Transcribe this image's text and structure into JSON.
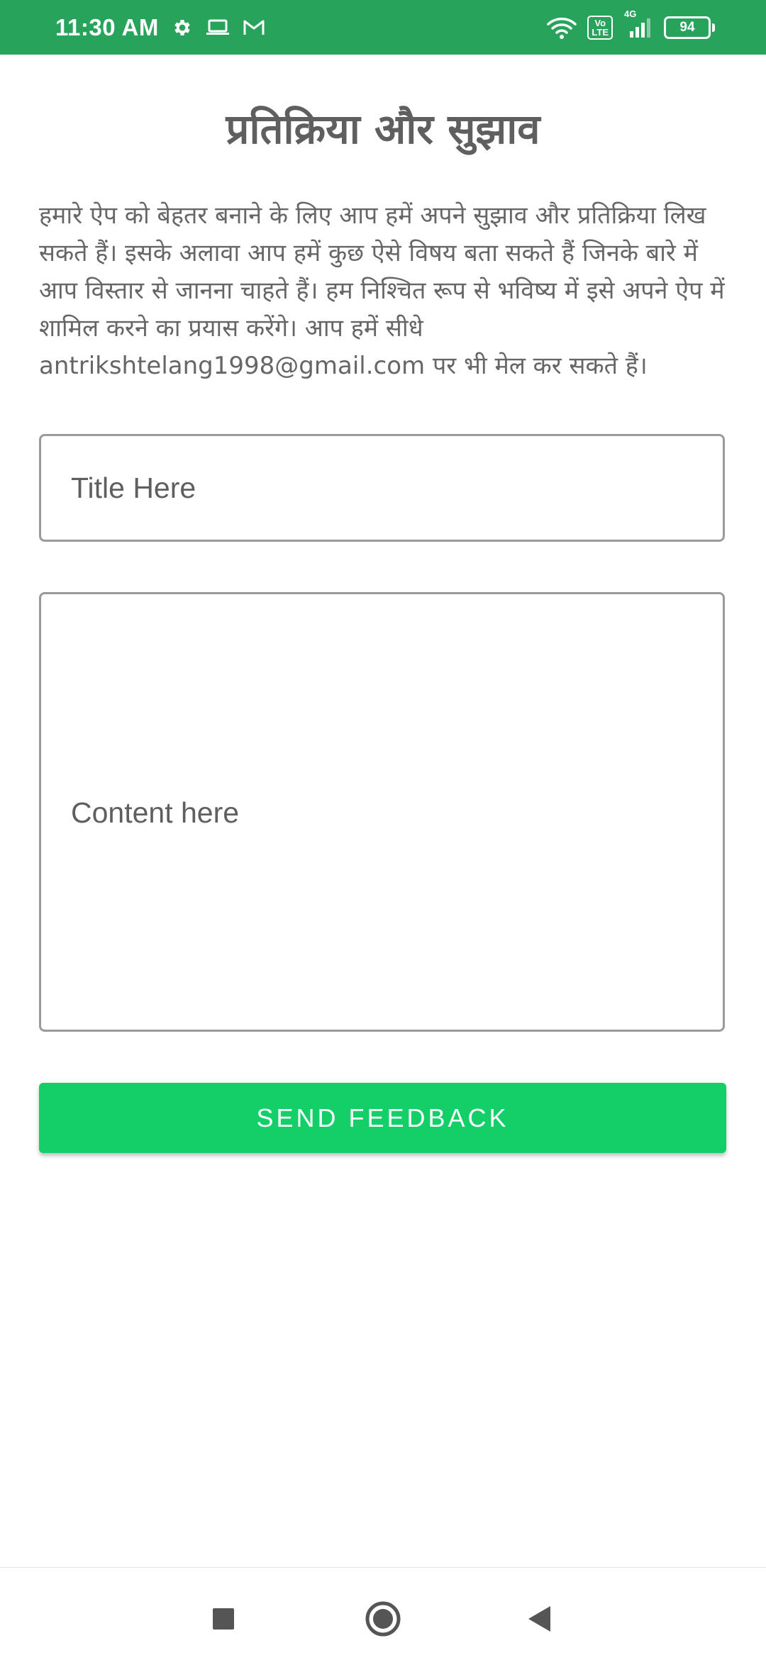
{
  "status_bar": {
    "time": "11:30 AM",
    "volte_line1": "Vo",
    "volte_line2": "LTE",
    "network": "4G",
    "battery": "94"
  },
  "page": {
    "title": "प्रतिक्रिया और सुझाव",
    "description": "हमारे ऐप को बेहतर बनाने के लिए आप हमें अपने सुझाव और प्रतिक्रिया लिख सकते हैं। इसके अलावा आप हमें कुछ ऐसे विषय बता सकते हैं जिनके बारे में आप विस्तार से जानना चाहते हैं। हम निश्चित रूप से भविष्य में इसे अपने ऐप में शामिल करने का प्रयास करेंगे। आप हमें सीधे antrikshtelang1998@gmail.com पर भी मेल कर सकते हैं।"
  },
  "form": {
    "title_placeholder": "Title Here",
    "title_value": "",
    "content_placeholder": "Content here",
    "content_value": "",
    "send_label": "SEND FEEDBACK"
  },
  "colors": {
    "status_bar": "#27a35b",
    "accent_button": "#12cf68"
  },
  "nav": {
    "icons": [
      "recents-icon",
      "home-icon",
      "back-icon"
    ]
  }
}
